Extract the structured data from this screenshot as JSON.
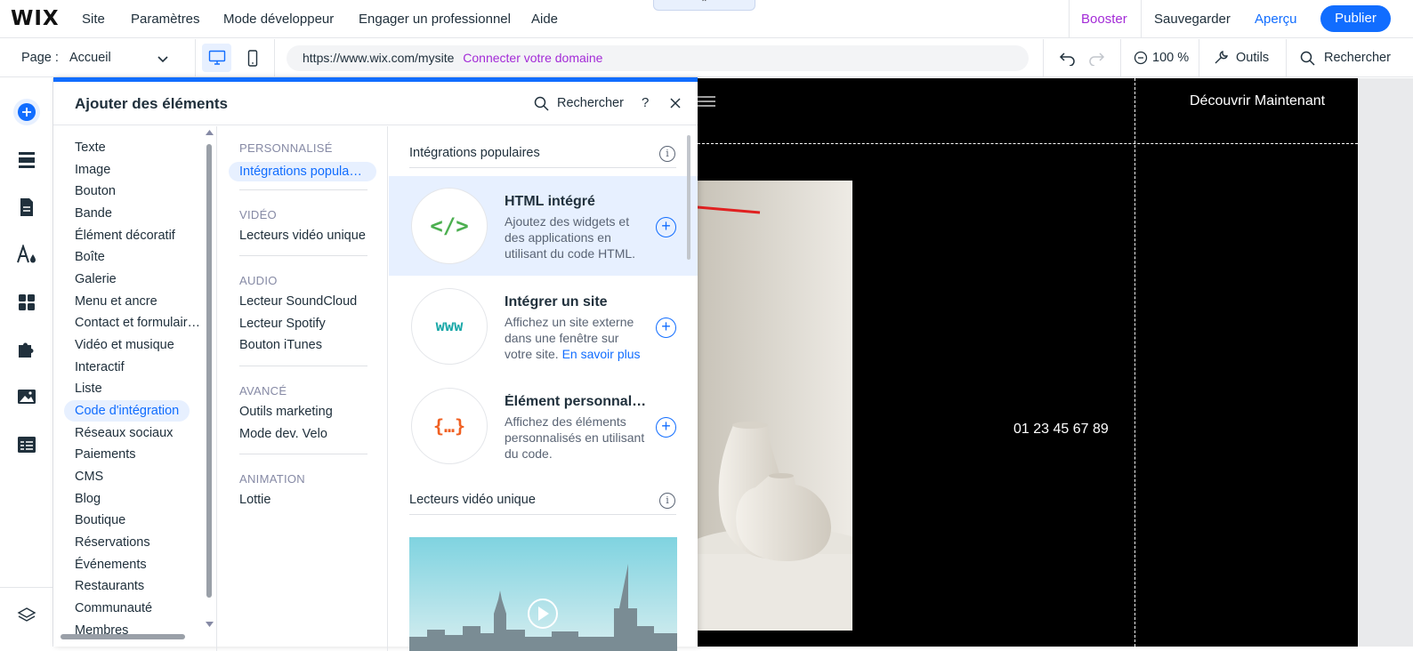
{
  "topbar": {
    "logo": "WIX",
    "menu": [
      "Site",
      "Paramètres",
      "Mode développeur",
      "Engager un professionnel",
      "Aide"
    ],
    "notch": "⌃",
    "booster": "Booster",
    "save": "Sauvegarder",
    "preview": "Aperçu",
    "publish": "Publier",
    "colors": {
      "booster": "#a32bd7",
      "accent": "#116dff"
    }
  },
  "secondbar": {
    "page_label": "Page :",
    "page_value": "Accueil",
    "url": "https://www.wix.com/mysite",
    "connect_domain": "Connecter votre domaine",
    "zoom": "100 %",
    "tools": "Outils",
    "search": "Rechercher"
  },
  "panel": {
    "title": "Ajouter des éléments",
    "search": "Rechercher",
    "help": "?",
    "categories": [
      "Texte",
      "Image",
      "Bouton",
      "Bande",
      "Élément décoratif",
      "Boîte",
      "Galerie",
      "Menu et ancre",
      "Contact et formulair…",
      "Vidéo et musique",
      "Interactif",
      "Liste",
      "Code d'intégration",
      "Réseaux sociaux",
      "Paiements",
      "CMS",
      "Blog",
      "Boutique",
      "Réservations",
      "Événements",
      "Restaurants",
      "Communauté",
      "Membres"
    ],
    "active_category": "Code d'intégration",
    "sections": {
      "custom_title": "PERSONNALISÉ",
      "custom_item": "Intégrations popula…",
      "video_title": "VIDÉO",
      "video_item": "Lecteurs vidéo unique",
      "audio_title": "AUDIO",
      "audio_items": [
        "Lecteur SoundCloud",
        "Lecteur Spotify",
        "Bouton iTunes"
      ],
      "advanced_title": "AVANCÉ",
      "advanced_items": [
        "Outils marketing",
        "Mode dev. Velo"
      ],
      "animation_title": "ANIMATION",
      "animation_item": "Lottie"
    },
    "popular_title": "Intégrations populaires",
    "cards": [
      {
        "icon": "</>",
        "title": "HTML intégré",
        "desc": "Ajoutez des widgets et des applications en utilisant du code HTML."
      },
      {
        "icon": "www",
        "title": "Intégrer un site",
        "desc": "Affichez un site externe dans une fenêtre sur votre site.",
        "link": "En savoir plus"
      },
      {
        "icon": "{…}",
        "title": "Élément personnal…",
        "desc": "Affichez des éléments personnalisés en utilisant du code."
      }
    ],
    "video_section_title": "Lecteurs vidéo unique"
  },
  "canvas": {
    "cta": "Découvrir Maintenant",
    "phone": "01 23 45 67 89"
  }
}
